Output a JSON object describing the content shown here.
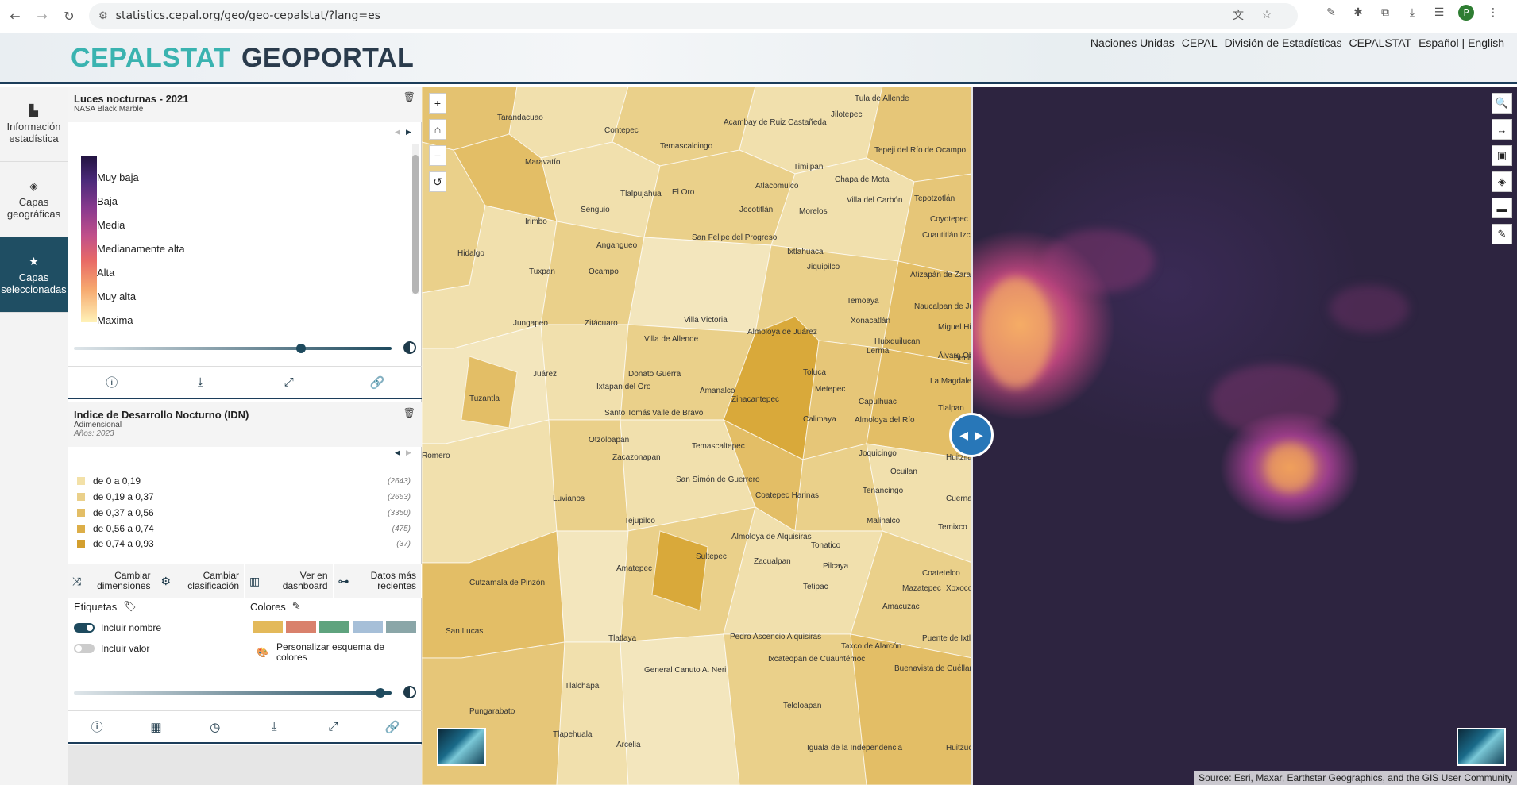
{
  "browser": {
    "url": "statistics.cepal.org/geo/geo-cepalstat/?lang=es",
    "profile_initial": "P"
  },
  "header": {
    "logo_part1": "CEPALSTAT",
    "logo_part2": "GEOPORTAL",
    "links": [
      "Naciones Unidas",
      "CEPAL",
      "División de Estadísticas",
      "CEPALSTAT",
      "Español | English"
    ]
  },
  "sidebar": {
    "items": [
      {
        "label": "Información estadística",
        "icon": "bar-chart-icon"
      },
      {
        "label": "Capas geográficas",
        "icon": "layers-icon"
      },
      {
        "label": "Capas seleccionadas",
        "icon": "star-icon"
      }
    ]
  },
  "layer1": {
    "title": "Luces nocturnas - 2021",
    "subtitle": "NASA Black Marble",
    "legend": [
      "Muy baja",
      "Baja",
      "Media",
      "Medianamente alta",
      "Alta",
      "Muy alta",
      "Maxima"
    ],
    "opacity": 0.7
  },
  "layer2": {
    "title": "Indice de Desarrollo Nocturno (IDN)",
    "unit": "Adimensional",
    "years": "Años: 2023",
    "classes": [
      {
        "label": "de 0 a 0,19",
        "count": "(2643)",
        "color": "#f3e1a8"
      },
      {
        "label": "de 0,19 a 0,37",
        "count": "(2663)",
        "color": "#ead08a"
      },
      {
        "label": "de 0,37 a 0,56",
        "count": "(3350)",
        "color": "#e3be66"
      },
      {
        "label": "de 0,56 a 0,74",
        "count": "(475)",
        "color": "#dcae48"
      },
      {
        "label": "de 0,74 a 0,93",
        "count": "(37)",
        "color": "#d39f2e"
      }
    ],
    "actions": [
      {
        "label": "Cambiar dimensiones",
        "icon": "shuffle-icon"
      },
      {
        "label": "Cambiar clasificación",
        "icon": "gear-icon"
      },
      {
        "label": "Ver en dashboard",
        "icon": "chart-icon"
      },
      {
        "label": "Datos más recientes",
        "icon": "sitemap-icon"
      }
    ],
    "labels_title": "Etiquetas",
    "include_name": "Incluir nombre",
    "include_value": "Incluir valor",
    "include_name_on": true,
    "include_value_on": false,
    "colors_title": "Colores",
    "color_schemes": [
      "#e3b95a",
      "#d9816c",
      "#5fa37e",
      "#a6bfd8",
      "#8aa6a8"
    ],
    "customize_colors": "Personalizar esquema de colores",
    "opacity": 0.95
  },
  "map": {
    "places": [
      "Tula de Allende",
      "Tarandacuao",
      "Jilotepec",
      "Acambay de Ruiz Castañeda",
      "Contepec",
      "Temascalcingo",
      "Tepeji del Río de Ocampo",
      "Maravatío",
      "Timilpan",
      "Chapa de Mota",
      "Tlalpujahua",
      "El Oro",
      "Atlacomulco",
      "Villa del Carbón",
      "Tepotzotlán",
      "Senguio",
      "Jocotitlán",
      "Morelos",
      "Coyotepec",
      "Irimbo",
      "San Felipe del Progreso",
      "Cuautitlán Izcalli",
      "Hidalgo",
      "Angangueo",
      "Ixtlahuaca",
      "Jiquipilco",
      "Atizapán de Zaragoza",
      "Tuxpan",
      "Ocampo",
      "Temoaya",
      "Naucalpan de Juárez",
      "Jungapeo",
      "Zitácuaro",
      "Villa Victoria",
      "Xonacatlán",
      "Miguel Hidalgo",
      "Almoloya de Juárez",
      "Huixquilucan",
      "Villa de Allende",
      "Lerma",
      "Álvaro Obregón",
      "Juárez",
      "Donato Guerra",
      "Toluca",
      "La Magdalena Contreras",
      "Ixtapan del Oro",
      "Amanalco",
      "Metepec",
      "Tuzantla",
      "Zinacantepec",
      "Capulhuac",
      "Tlalpan",
      "Santo Tomás",
      "Valle de Bravo",
      "Calimaya",
      "Almoloya del Río",
      "Otzoloapan",
      "Temascaltepec",
      "Joquicingo",
      "Huitzilac",
      "Zacazonapan",
      "Ocuilan",
      "San Simón de Guerrero",
      "Coatepec Harinas",
      "Tenancingo",
      "Cuernavaca",
      "Luvianos",
      "Tejupilco",
      "Malinalco",
      "Temixco",
      "Almoloya de Alquisiras",
      "Tonatico",
      "Amatepec",
      "Sultepec",
      "Zacualpan",
      "Pilcaya",
      "Coatetelco",
      "Cutzamala de Pinzón",
      "Tetipac",
      "Mazatepec",
      "Xoxocotla",
      "Amacuzac",
      "San Lucas",
      "Tlatlaya",
      "Pedro Ascencio Alquisiras",
      "Taxco de Alarcón",
      "Puente de Ixtla",
      "General Canuto A. Neri",
      "Ixcateopan de Cuauhtémoc",
      "Buenavista de Cuéllar",
      "Tlalchapa",
      "Pungarabato",
      "Teloloapan",
      "Tlapehuala",
      "Arcelia",
      "Iguala de la Independencia",
      "Huitzuco de los Figueroa",
      "Romero",
      "Benito"
    ],
    "controls": [
      "+",
      "⌂",
      "−",
      "↺"
    ],
    "attribution": "Source: Esri, Maxar, Earthstar Geographics, and the GIS User Community"
  }
}
